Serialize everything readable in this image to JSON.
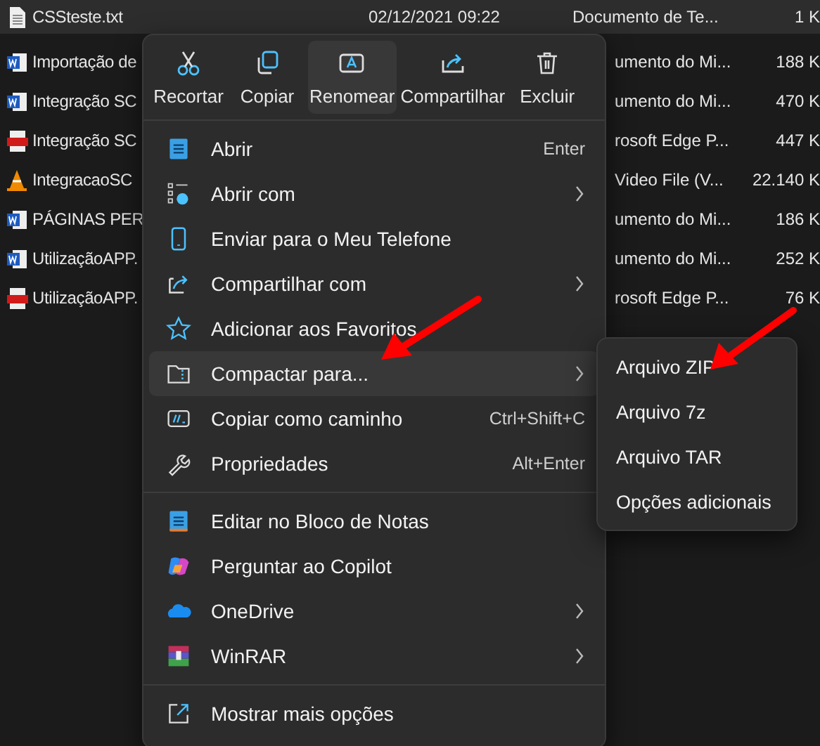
{
  "files": [
    {
      "name": "CSSteste.txt",
      "date": "02/12/2021 09:22",
      "type": "Documento de Te...",
      "size": "1 K",
      "selected": true
    },
    {
      "name": "Importação de",
      "type": "umento do Mi...",
      "size": "188 K",
      "selected": false
    },
    {
      "name": "Integração SC",
      "type": "umento do Mi...",
      "size": "470 K",
      "selected": false
    },
    {
      "name": "Integração SC",
      "type": "rosoft Edge P...",
      "size": "447 K",
      "selected": false
    },
    {
      "name": "IntegracaoSC",
      "type": "Video File (V...",
      "size": "22.140 K",
      "selected": false
    },
    {
      "name": "PÁGINAS PER",
      "type": "umento do Mi...",
      "size": "186 K",
      "selected": false
    },
    {
      "name": "UtilizaçãoAPP.",
      "type": "umento do Mi...",
      "size": "252 K",
      "selected": false
    },
    {
      "name": "UtilizaçãoAPP.",
      "type": "rosoft Edge P...",
      "size": "76 K",
      "selected": false
    }
  ],
  "context_menu": {
    "toolbar": [
      {
        "label": "Recortar",
        "selected": false
      },
      {
        "label": "Copiar",
        "selected": false
      },
      {
        "label": "Renomear",
        "selected": true
      },
      {
        "label": "Compartilhar",
        "selected": false
      },
      {
        "label": "Excluir",
        "selected": false
      }
    ],
    "groups": [
      [
        {
          "label": "Abrir",
          "shortcut": "Enter",
          "submenu": false,
          "selected": false
        },
        {
          "label": "Abrir com",
          "submenu": true,
          "selected": false
        },
        {
          "label": "Enviar para o Meu Telefone",
          "submenu": false,
          "selected": false
        },
        {
          "label": "Compartilhar com",
          "submenu": true,
          "selected": false
        },
        {
          "label": "Adicionar aos Favoritos",
          "submenu": false,
          "selected": false
        },
        {
          "label": "Compactar para...",
          "submenu": true,
          "selected": true
        },
        {
          "label": "Copiar como caminho",
          "shortcut": "Ctrl+Shift+C",
          "submenu": false,
          "selected": false
        },
        {
          "label": "Propriedades",
          "shortcut": "Alt+Enter",
          "submenu": false,
          "selected": false
        }
      ],
      [
        {
          "label": "Editar no Bloco de Notas",
          "submenu": false,
          "selected": false
        },
        {
          "label": "Perguntar ao Copilot",
          "submenu": false,
          "selected": false
        },
        {
          "label": "OneDrive",
          "submenu": true,
          "selected": false
        },
        {
          "label": "WinRAR",
          "submenu": true,
          "selected": false
        }
      ],
      [
        {
          "label": "Mostrar mais opções",
          "submenu": false,
          "selected": false
        }
      ]
    ]
  },
  "submenu": {
    "items": [
      {
        "label": "Arquivo ZIP",
        "selected": false
      },
      {
        "label": "Arquivo 7z",
        "selected": false
      },
      {
        "label": "Arquivo TAR",
        "selected": false
      },
      {
        "label": "Opções adicionais",
        "selected": false
      }
    ]
  }
}
